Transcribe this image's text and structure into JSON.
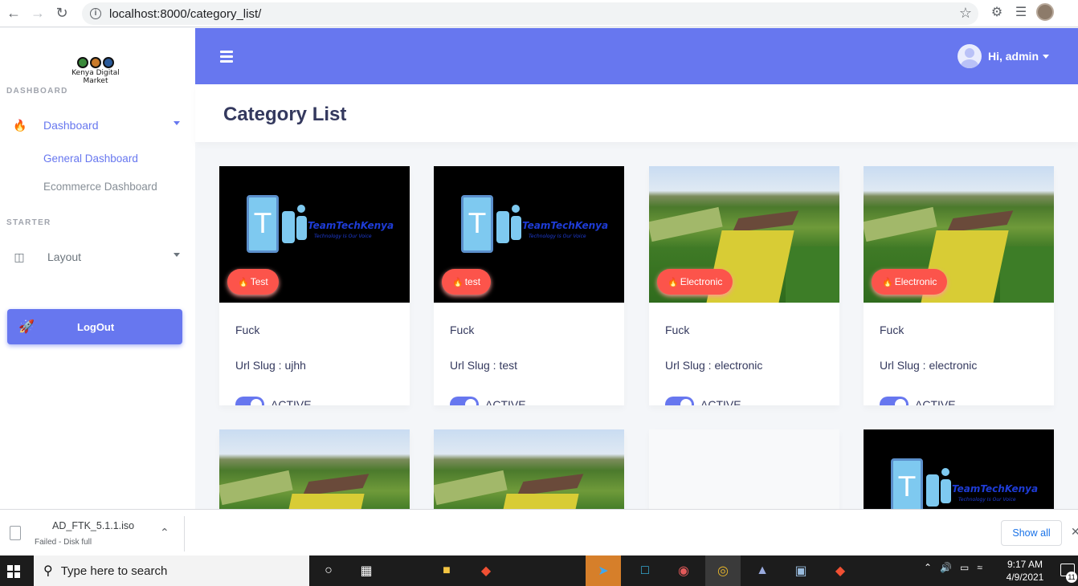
{
  "browser": {
    "url": "localhost:8000/category_list/"
  },
  "sidebar": {
    "brand_name": "Kenya Digital Market",
    "header_dashboard": "DASHBOARD",
    "header_starter": "STARTER",
    "dashboard_label": "Dashboard",
    "sub_items": [
      "General Dashboard",
      "Ecommerce Dashboard"
    ],
    "layout_label": "Layout",
    "logout_label": "LogOut"
  },
  "topnav": {
    "greeting": "Hi, admin"
  },
  "page": {
    "title": "Category List"
  },
  "cards": [
    {
      "badge": "Test",
      "title": "Fuck",
      "slug": "Url Slug : ujhh",
      "status": "ACTIVE",
      "image": "teamtechkenya-logo"
    },
    {
      "badge": "test",
      "title": "Fuck",
      "slug": "Url Slug : test",
      "status": "ACTIVE",
      "image": "teamtechkenya-logo"
    },
    {
      "badge": "Electronic",
      "title": "Fuck",
      "slug": "Url Slug : electronic",
      "status": "ACTIVE",
      "image": "farm-field"
    },
    {
      "badge": "Electronic",
      "title": "Fuck",
      "slug": "Url Slug : electronic",
      "status": "ACTIVE",
      "image": "farm-field"
    }
  ],
  "logo_text": {
    "name": "TeamTechKenya",
    "tagline": "Technology Is Our Voice"
  },
  "download_bar": {
    "file_name": "AD_FTK_5.1.1.iso",
    "status": "Failed - Disk full",
    "show_all": "Show all"
  },
  "taskbar": {
    "search_placeholder": "Type here to search",
    "time": "9:17 AM",
    "date": "4/9/2021",
    "notification_count": "11"
  },
  "colors": {
    "primary": "#6777ef",
    "badge": "#fc544b"
  }
}
